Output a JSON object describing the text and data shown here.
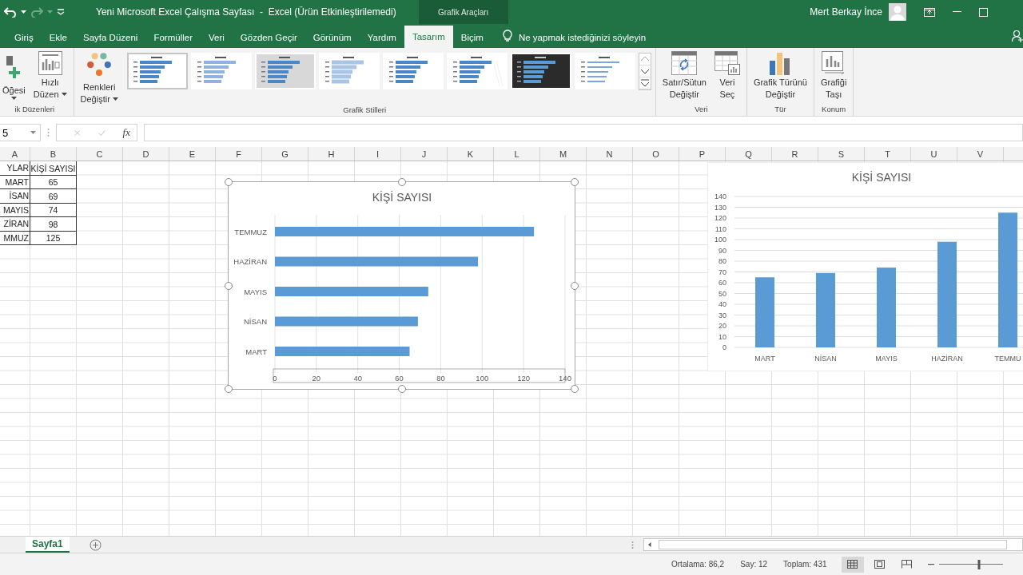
{
  "title_bar": {
    "title": "Yeni Microsoft Excel Çalışma Sayfası  -  Excel (Ürün Etkinleştirilemedi)",
    "context_tab": "Grafik Araçları",
    "user": "Mert Berkay İnce"
  },
  "tabs": [
    {
      "label": "Giriş",
      "selected": false
    },
    {
      "label": "Ekle",
      "selected": false
    },
    {
      "label": "Sayfa Düzeni",
      "selected": false
    },
    {
      "label": "Formüller",
      "selected": false
    },
    {
      "label": "Veri",
      "selected": false
    },
    {
      "label": "Gözden Geçir",
      "selected": false
    },
    {
      "label": "Görünüm",
      "selected": false
    },
    {
      "label": "Yardım",
      "selected": false
    },
    {
      "label": "Tasarım",
      "selected": true
    },
    {
      "label": "Biçim",
      "selected": false
    }
  ],
  "tell_me": "Ne yapmak istediğinizi söyleyin",
  "ribbon": {
    "layouts": {
      "label": "ik Düzenleri",
      "buttons": [
        {
          "kind": "add",
          "lines": [
            "Öğesi"
          ],
          "caret": true
        },
        {
          "kind": "layout",
          "lines": [
            "Hızlı",
            "Düzen"
          ],
          "caret": true
        }
      ]
    },
    "colors": {
      "lines": [
        "Renkleri",
        "Değiştir"
      ],
      "caret": true
    },
    "styles": {
      "label": "Grafik Stilleri",
      "items": [
        {
          "kind": "light",
          "selected": true
        },
        {
          "kind": "dotted",
          "selected": false
        },
        {
          "kind": "gray",
          "selected": false
        },
        {
          "kind": "faded",
          "selected": false
        },
        {
          "kind": "light",
          "selected": false
        },
        {
          "kind": "hatched",
          "selected": false
        },
        {
          "kind": "dark",
          "selected": false
        },
        {
          "kind": "thin",
          "selected": false
        }
      ]
    },
    "groups": [
      {
        "label": "Veri",
        "buttons": [
          {
            "kind": "switch",
            "lines": [
              "Satır/Sütun",
              "Değiştir"
            ]
          },
          {
            "kind": "select",
            "lines": [
              "Veri",
              "Seç"
            ]
          }
        ]
      },
      {
        "label": "Tür",
        "buttons": [
          {
            "kind": "type",
            "lines": [
              "Grafik Türünü",
              "Değiştir"
            ]
          }
        ]
      },
      {
        "label": "Konum",
        "buttons": [
          {
            "kind": "move",
            "lines": [
              "Grafiği",
              "Taşı"
            ]
          }
        ]
      }
    ]
  },
  "formula_bar": {
    "name_box": "5",
    "fx": "fx"
  },
  "columns": [
    "A",
    "B",
    "C",
    "D",
    "E",
    "F",
    "G",
    "H",
    "I",
    "J",
    "K",
    "L",
    "M",
    "N",
    "O",
    "P",
    "Q",
    "R",
    "S",
    "T",
    "U",
    "V"
  ],
  "cells": [
    [
      "YLAR",
      "KİŞİ SAYISI"
    ],
    [
      "MART",
      "65"
    ],
    [
      "İSAN",
      "69"
    ],
    [
      "MAYIS",
      "74"
    ],
    [
      "ZİRAN",
      "98"
    ],
    [
      "MMUZ",
      "125"
    ]
  ],
  "charts": [
    {
      "selected": true,
      "chart_data": {
        "type": "bar",
        "orientation": "horizontal",
        "title": "KİŞİ SAYISI",
        "categories": [
          "TEMMUZ",
          "HAZİRAN",
          "MAYIS",
          "NİSAN",
          "MART"
        ],
        "values": [
          125,
          98,
          74,
          69,
          65
        ],
        "xlim": [
          0,
          140
        ],
        "xticks": [
          0,
          20,
          40,
          60,
          80,
          100,
          120,
          140
        ],
        "grid": true
      }
    },
    {
      "selected": false,
      "chart_data": {
        "type": "bar",
        "orientation": "vertical",
        "title": "KİŞİ SAYISI",
        "categories": [
          "MART",
          "NİSAN",
          "MAYIS",
          "HAZİRAN",
          "TEMMU"
        ],
        "values": [
          65,
          69,
          74,
          98,
          125
        ],
        "ylim": [
          0,
          140
        ],
        "yticks": [
          0,
          10,
          20,
          30,
          40,
          50,
          60,
          70,
          80,
          90,
          100,
          110,
          120,
          130,
          140
        ],
        "grid": true
      }
    }
  ],
  "sheet_tabs": [
    {
      "label": "Sayfa1",
      "selected": true
    }
  ],
  "status_bar": {
    "average": "Ortalama: 86,2",
    "count": "Say: 12",
    "sum": "Toplam: 431",
    "views": [
      {
        "kind": "normal",
        "selected": true
      },
      {
        "kind": "page",
        "selected": false
      },
      {
        "kind": "break",
        "selected": false
      }
    ],
    "zoom": {
      "level": 0.5
    }
  }
}
